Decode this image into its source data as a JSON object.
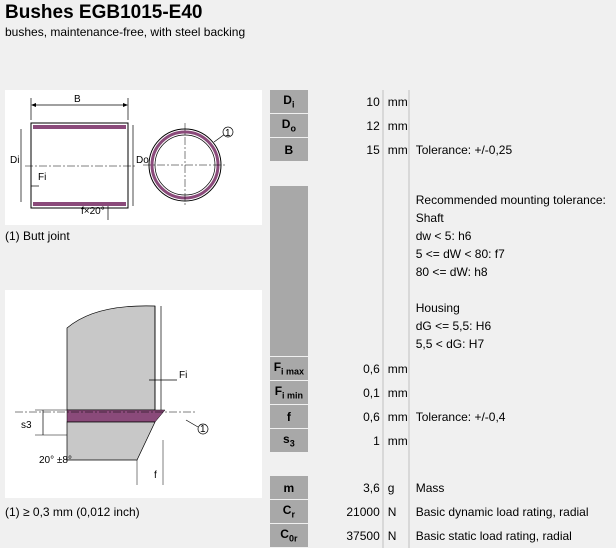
{
  "header": {
    "title": "Bushes EGB1015-E40",
    "subtitle": "bushes, maintenance-free, with steel backing"
  },
  "figure1": {
    "label_B": "B",
    "label_Di": "Di",
    "label_Do": "Do",
    "label_Fi": "Fi",
    "label_fx20": "f×20°",
    "callout": "1",
    "caption": "(1) Butt joint"
  },
  "figure2": {
    "label_Fi": "Fi",
    "label_s3": "s3",
    "label_f": "f",
    "label_angle": "20° ±8°",
    "callout": "1",
    "caption": "(1) ≥ 0,3 mm (0,012 inch)"
  },
  "specs": {
    "Di": {
      "sym": "D",
      "sub": "i",
      "value": "10",
      "unit": "mm",
      "desc": ""
    },
    "Do": {
      "sym": "D",
      "sub": "o",
      "value": "12",
      "unit": "mm",
      "desc": ""
    },
    "B": {
      "sym": "B",
      "value": "15",
      "unit": "mm",
      "desc": "Tolerance: +/-0,25"
    },
    "tolerance_lines": [
      "Recommended mounting tolerance:",
      "Shaft",
      "dw < 5: h6",
      "5 <= dW < 80: f7",
      "80 <= dW: h8",
      "",
      "Housing",
      "dG <= 5,5: H6",
      "5,5 < dG: H7"
    ],
    "Fimax": {
      "sym": "F",
      "sub": "i max",
      "value": "0,6",
      "unit": "mm",
      "desc": ""
    },
    "Fimin": {
      "sym": "F",
      "sub": "i min",
      "value": "0,1",
      "unit": "mm",
      "desc": ""
    },
    "f": {
      "sym": "f",
      "value": "0,6",
      "unit": "mm",
      "desc": "Tolerance: +/-0,4"
    },
    "s3": {
      "sym": "s",
      "sub": "3",
      "value": "1",
      "unit": "mm",
      "desc": ""
    },
    "m": {
      "sym": "m",
      "value": "3,6",
      "unit": "g",
      "desc": "Mass"
    },
    "Cr": {
      "sym": "C",
      "sub": "r",
      "value": "21000",
      "unit": "N",
      "desc": "Basic dynamic load rating, radial"
    },
    "C0r": {
      "sym": "C",
      "sub": "0r",
      "value": "37500",
      "unit": "N",
      "desc": "Basic static load rating, radial"
    }
  }
}
